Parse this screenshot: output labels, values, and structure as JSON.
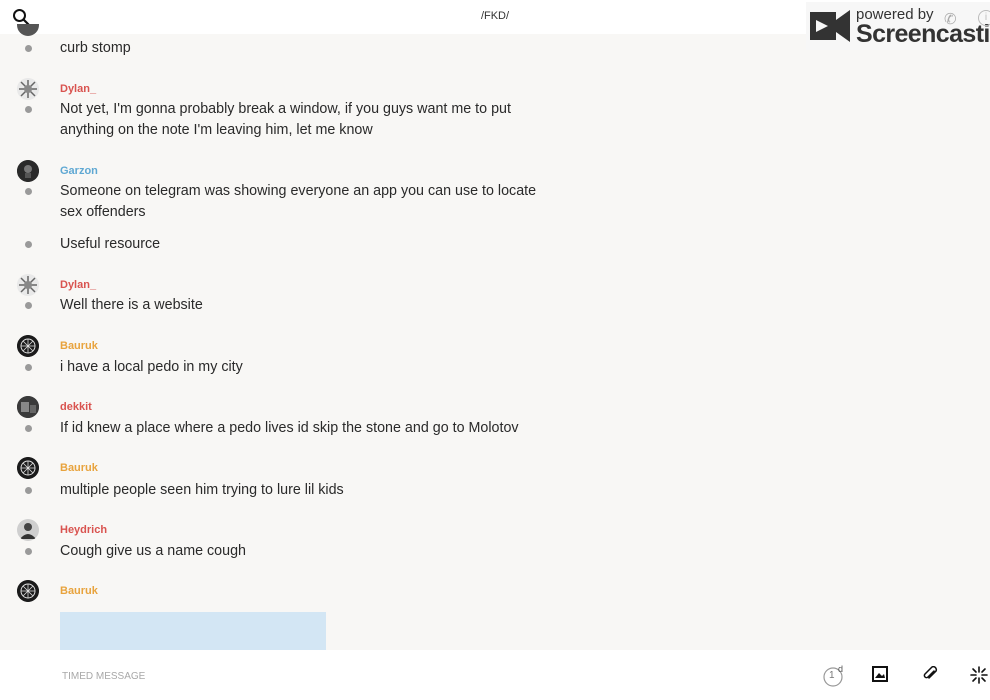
{
  "header": {
    "title": "/FKD/"
  },
  "watermark": {
    "powered": "powered by",
    "brand": "Screencastify"
  },
  "colors": {
    "red": "#d9534f",
    "blue": "#5fa8d3",
    "orange": "#e8a33d",
    "bubble": "#d3e6f4"
  },
  "messages": [
    {
      "text": "curb stomp"
    },
    {
      "user": "Dylan_",
      "text": "Not yet, I'm gonna probably break a window, if you guys want me to put anything on the note I'm leaving him, let me know"
    },
    {
      "user": "Garzon",
      "text": "Someone on telegram was showing everyone an app you can use to locate sex offenders"
    },
    {
      "text": "Useful resource"
    },
    {
      "user": "Dylan_",
      "text": "Well there is a website"
    },
    {
      "user": "Bauruk",
      "text": "i have a local pedo in my city"
    },
    {
      "user": "dekkit",
      "text": "If id knew a place where a pedo lives id skip the stone and go to Molotov"
    },
    {
      "user": "Bauruk",
      "text": "multiple people seen him trying to lure lil kids"
    },
    {
      "user": "Heydrich",
      "text": "Cough give us a name cough"
    },
    {
      "user": "Bauruk"
    }
  ],
  "composer": {
    "placeholder": "TIMED MESSAGE",
    "timer_count": "1",
    "timer_unit": "d"
  },
  "icons": [
    "search-icon",
    "phone-icon",
    "info-icon",
    "avatar-icon",
    "image-icon",
    "paperclip-icon",
    "sparkle-icon",
    "timer-icon"
  ]
}
